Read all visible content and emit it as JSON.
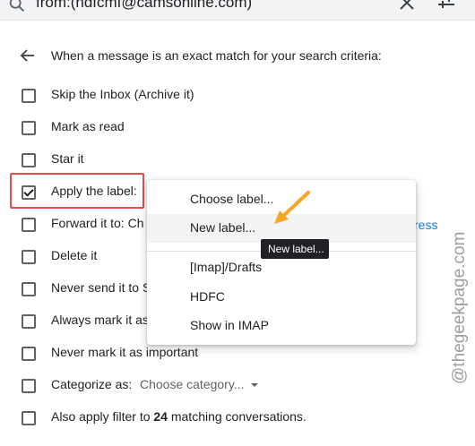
{
  "search": {
    "query": "from:(hdfcmf@camsonline.com)"
  },
  "header": {
    "text": "When a message is an exact match for your search criteria:"
  },
  "options": [
    {
      "label": "Skip the Inbox (Archive it)",
      "checked": false
    },
    {
      "label": "Mark as read",
      "checked": false
    },
    {
      "label": "Star it",
      "checked": false
    },
    {
      "label": "Apply the label:",
      "checked": true
    },
    {
      "label": "Forward it to:",
      "suffix": "Ch",
      "checked": false
    },
    {
      "label": "Delete it",
      "checked": false
    },
    {
      "label": "Never send it to S",
      "checked": false
    },
    {
      "label": "Always mark it as",
      "checked": false
    },
    {
      "label": "Never mark it as important",
      "checked": false
    },
    {
      "label": "Categorize as:",
      "checked": false
    },
    {
      "label_pre": "Also apply filter to ",
      "count": "24",
      "label_post": " matching conversations.",
      "checked": false
    }
  ],
  "categorize": {
    "value": "Choose category..."
  },
  "forward_link": {
    "text": "ress"
  },
  "menu": {
    "items": [
      {
        "label": "Choose label..."
      },
      {
        "label": "New label..."
      },
      {
        "label": "[Imap]/Drafts"
      },
      {
        "label": "HDFC"
      },
      {
        "label": "Show in IMAP"
      }
    ]
  },
  "tooltip": {
    "text": "New label..."
  },
  "watermark": {
    "text": "@thegeekpage.com"
  },
  "colors": {
    "highlight_box": "#e84b4b",
    "annotation_arrow": "#f5a623",
    "link": "#1a73e8",
    "menu_hover": "#f1f3f4"
  },
  "icons": {
    "search": "search-icon",
    "close": "close-icon",
    "tune": "tune-icon",
    "back": "back-arrow-icon"
  }
}
